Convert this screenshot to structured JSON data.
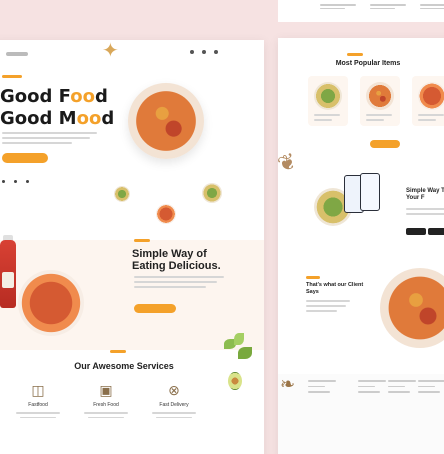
{
  "hero": {
    "title_line1_start": "Good F",
    "title_line1_oo": "oo",
    "title_line1_end": "d",
    "title_line2_start": "Good M",
    "title_line2_oo": "oo",
    "title_line2_end": "d"
  },
  "about": {
    "title": "Simple Way of Eating Delicious."
  },
  "services": {
    "title": "Our Awesome Services",
    "items": [
      {
        "name": "Fastfood",
        "icon": "burger-icon"
      },
      {
        "name": "Fresh Food",
        "icon": "food-box-icon"
      },
      {
        "name": "Fast Delivery",
        "icon": "scooter-icon"
      }
    ]
  },
  "right_page": {
    "popular_title": "Most Popular Items",
    "app_title": "Simple Way To Order Your F",
    "menu_title": "That's what our Client Says"
  },
  "colors": {
    "accent": "#f4a12a",
    "background": "#f6e2e2"
  }
}
